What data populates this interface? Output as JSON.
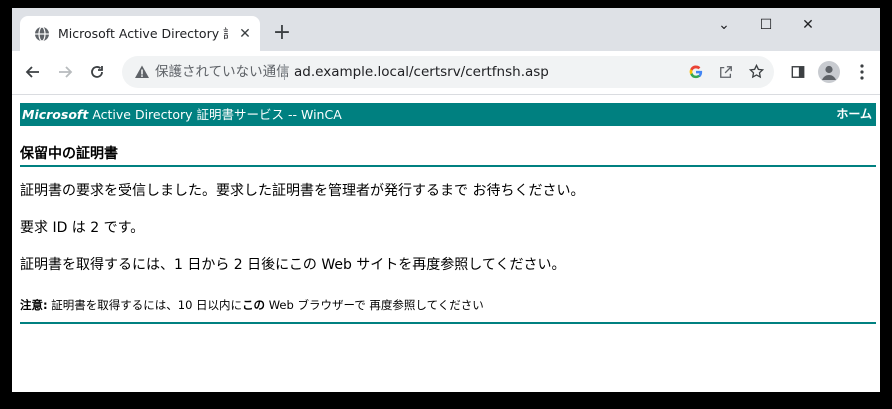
{
  "browser": {
    "tab_title": "Microsoft Active Directory 証明書",
    "tab_close": "✕",
    "new_tab": "+",
    "window_controls": {
      "minimize": "⌄",
      "restore": "☐",
      "close": "✕"
    }
  },
  "address_bar": {
    "security_label": "保護されていない通信",
    "url": "ad.example.local/certsrv/certfnsh.asp"
  },
  "page": {
    "banner": {
      "brand": "Microsoft",
      "title": "Active Directory 証明書サービス  --  WinCA",
      "home_link": "ホーム"
    },
    "heading": "保留中の証明書",
    "paragraphs": [
      "証明書の要求を受信しました。要求した証明書を管理者が発行するまで お待ちください。",
      "要求 ID は 2 です。",
      "証明書を取得するには、1 日から 2 日後にこの Web サイトを再度参照してください。"
    ],
    "note": {
      "label": "注意:",
      "text_before": " 証明書を取得するには、10 日以内に",
      "emphasis": "この",
      "text_after": " Web ブラウザーで 再度参照してください"
    }
  },
  "colors": {
    "accent": "#008080",
    "tabstrip": "#dee1e6",
    "omnibox": "#f1f3f4"
  },
  "icons": {
    "favicon": "globe-icon",
    "security": "warning-triangle-icon",
    "back": "back-arrow-icon",
    "forward": "forward-arrow-icon",
    "reload": "reload-icon",
    "google": "google-icon",
    "share": "share-icon",
    "bookmark": "star-icon",
    "side_panel": "side-panel-icon",
    "profile": "profile-icon",
    "menu": "kebab-menu-icon"
  }
}
